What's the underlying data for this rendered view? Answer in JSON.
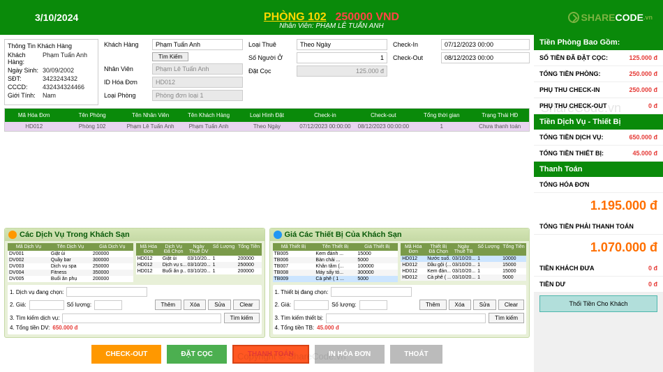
{
  "header": {
    "date": "3/10/2024",
    "room": "PHÒNG 102",
    "price": "250000 VND",
    "staff_label": "Nhân Viên:",
    "staff_name": "PHẠM LÊ TUẤN ANH",
    "logo1": "SHARE",
    "logo2": "CODE",
    "logo3": ".vn"
  },
  "customer_panel": {
    "title": "Thông Tin Khách Hàng",
    "rows": [
      {
        "lbl": "Khách Hàng:",
        "val": "Phạm Tuấn Anh",
        "cls": ""
      },
      {
        "lbl": "Ngày Sinh:",
        "val": "30/09/2002",
        "cls": "red"
      },
      {
        "lbl": "SĐT:",
        "val": "3423243432",
        "cls": "green-t"
      },
      {
        "lbl": "CCCD:",
        "val": "432434324466",
        "cls": "blue"
      },
      {
        "lbl": "Giới Tính:",
        "val": "Nam",
        "cls": "blue"
      }
    ]
  },
  "form1": {
    "customer_lbl": "Khách Hàng",
    "customer_val": "Phạm Tuấn Anh",
    "search_btn": "Tìm Kiếm",
    "staff_lbl": "Nhân Viên",
    "staff_val": "Phạm Lê Tuấn Anh",
    "inv_lbl": "ID Hóa Đơn",
    "inv_val": "HD012",
    "roomtype_lbl": "Loại Phòng",
    "roomtype_val": "Phòng đơn loại 1"
  },
  "form2": {
    "rent_lbl": "Loại Thuê",
    "rent_val": "Theo Ngày",
    "guests_lbl": "Số Người Ở",
    "guests_val": "1",
    "deposit_lbl": "Đặt Cọc",
    "deposit_val": "125.000 đ"
  },
  "form3": {
    "checkin_lbl": "Check-In",
    "checkin_val": "07/12/2023 00:00",
    "checkout_lbl": "Check-Out",
    "checkout_val": "08/12/2023 00:00"
  },
  "invoice_table": {
    "headers": [
      "Mã Hóa Đơn",
      "Tên Phòng",
      "Tên Nhân Viên",
      "Tên Khách Hàng",
      "Loại Hình Đặt",
      "Check-in",
      "Check-out",
      "Tổng thời gian",
      "Trạng Thái HĐ"
    ],
    "row": [
      "HD012",
      "Phòng 102",
      "Phạm Lê Tuấn Anh",
      "Phạm Tuấn Anh",
      "Theo Ngày",
      "07/12/2023 00:00:00",
      "08/12/2023 00:00:00",
      "1",
      "Chưa thanh toán"
    ]
  },
  "services": {
    "title": "Các Dịch Vụ Trong Khách Sạn",
    "headers_left": [
      "Mã Dịch Vụ",
      "Tên Dịch Vụ",
      "Giá Dịch Vụ"
    ],
    "rows_left": [
      [
        "DV001",
        "Giặt ủi",
        "200000"
      ],
      [
        "DV002",
        "Quầy bar",
        "300000"
      ],
      [
        "DV003",
        "Dịch vụ spa",
        "250000"
      ],
      [
        "DV004",
        "Fitness",
        "350000"
      ],
      [
        "DV005",
        "Buổi ăn phụ",
        "200000"
      ]
    ],
    "headers_right": [
      "Mã Hóa Đơn",
      "Dịch Vụ Đã Chọn",
      "Ngày Thuê DV",
      "Số Lượng",
      "Tổng Tiền"
    ],
    "rows_right": [
      [
        "HD012",
        "Giặt ủi",
        "03/10/20...",
        "1",
        "200000"
      ],
      [
        "HD012",
        "Dịch vụ s...",
        "03/10/20...",
        "1",
        "250000"
      ],
      [
        "HD012",
        "Buổi ăn p...",
        "03/10/20...",
        "1",
        "200000"
      ]
    ],
    "l1": "1. Dịch vụ đang chọn:",
    "l2a": "2. Giá:",
    "l2b": "Số lượng:",
    "l3": "3. Tìm kiếm dịch vụ:",
    "l4": "4. Tổng tiền DV:",
    "l4v": "650.000 đ",
    "btns": [
      "Thêm",
      "Xóa",
      "Sửa",
      "Clear"
    ],
    "search": "Tìm kiếm"
  },
  "equipment": {
    "title": "Giá Các Thiết Bị Của Khách Sạn",
    "headers_left": [
      "Mã Thiết Bị",
      "Tên Thiết Bị",
      "Giá Thiết Bị"
    ],
    "rows_left": [
      [
        "TB005",
        "Kem đánh ...",
        "15000"
      ],
      [
        "TB006",
        "Bàn chải ...",
        "5000"
      ],
      [
        "TB007",
        "Khăn tắm (...",
        "100000"
      ],
      [
        "TB008",
        "Máy sấy tó...",
        "300000"
      ],
      [
        "TB009",
        "Cà phê ( 1 ...",
        "5000"
      ]
    ],
    "headers_right": [
      "Mã Hóa Đơn",
      "Thiết Bị Đã Chọn",
      "Ngày Thuê TB",
      "Số Lượng",
      "Tổng Tiền"
    ],
    "rows_right": [
      [
        "HD012",
        "Nước suố...",
        "03/10/20...",
        "1",
        "10000"
      ],
      [
        "HD012",
        "Dầu gội (...",
        "03/10/20...",
        "1",
        "15000"
      ],
      [
        "HD012",
        "Kem đán...",
        "03/10/20...",
        "1",
        "15000"
      ],
      [
        "HD012",
        "Cà phê ( ...",
        "03/10/20...",
        "1",
        "5000"
      ]
    ],
    "l1": "1. Thiết bị đang chọn:",
    "l2a": "2. Giá:",
    "l2b": "Số lượng:",
    "l3": "3. Tìm kiếm thiết bị:",
    "l4": "4. Tổng tiền TB:",
    "l4v": "45.000 đ",
    "btns": [
      "Thêm",
      "Xóa",
      "Sửa",
      "Clear"
    ],
    "search": "Tìm kiếm"
  },
  "actions": {
    "checkout": "CHECK-OUT",
    "deposit": "ĐẶT CỌC",
    "pay": "THANH TOÁN",
    "print": "IN HÓA ĐƠN",
    "exit": "THOÁT"
  },
  "summary": {
    "sec1": "Tiền Phòng Bao Gồm:",
    "rows1": [
      {
        "lbl": "SỐ TIỀN ĐÃ ĐẶT CỌC:",
        "val": "125.000 đ"
      },
      {
        "lbl": "TỔNG TIỀN PHÒNG:",
        "val": "250.000 đ"
      },
      {
        "lbl": "PHỤ THU CHECK-IN",
        "val": "250.000 đ"
      },
      {
        "lbl": "PHỤ THU CHECK-OUT",
        "val": "0 đ"
      }
    ],
    "sec2": "Tiền Dịch Vụ - Thiết Bị",
    "rows2": [
      {
        "lbl": "TỔNG TIỀN DỊCH VỤ:",
        "val": "650.000 đ"
      },
      {
        "lbl": "TỔNG TIỀN THIẾT BỊ:",
        "val": "45.000 đ"
      }
    ],
    "sec3": "Thanh Toán",
    "total_lbl": "TỔNG HÓA ĐƠN",
    "total_val": "1.195.000 đ",
    "pay_lbl": "TỔNG TIỀN PHẢI THANH TOÁN",
    "pay_val": "1.070.000 đ",
    "given_lbl": "TIỀN KHÁCH ĐƯA",
    "given_val": "0 đ",
    "change_lbl": "TIỀN DƯ",
    "change_val": "0 đ",
    "return_btn": "Thối Tiền Cho Khách"
  },
  "watermarks": {
    "w1": "ShareCode.vn",
    "w2": "Copyright © ShareCode.vn"
  }
}
